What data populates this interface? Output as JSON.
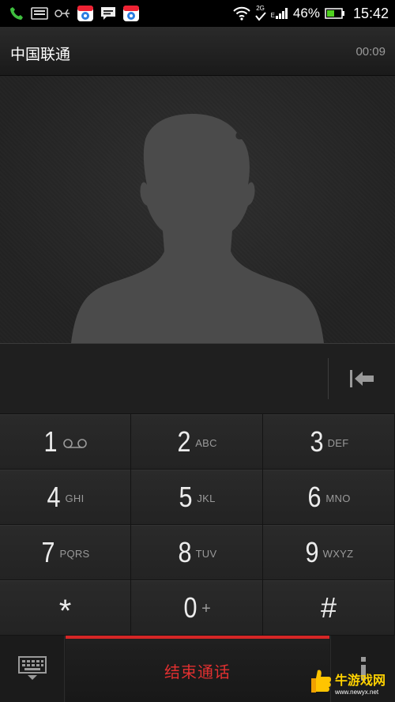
{
  "status_bar": {
    "left_icons": [
      "phone-icon",
      "message-card-icon",
      "usb-icon",
      "app-store-icon",
      "chat-icon",
      "app-store-icon"
    ],
    "network_type": "2G",
    "signal_letter": "E",
    "battery_percent": "46%",
    "time": "15:42"
  },
  "header": {
    "carrier": "中国联通",
    "call_duration": "00:09"
  },
  "keypad": {
    "keys": [
      {
        "digit": "1",
        "letters": ""
      },
      {
        "digit": "2",
        "letters": "ABC"
      },
      {
        "digit": "3",
        "letters": "DEF"
      },
      {
        "digit": "4",
        "letters": "GHI"
      },
      {
        "digit": "5",
        "letters": "JKL"
      },
      {
        "digit": "6",
        "letters": "MNO"
      },
      {
        "digit": "7",
        "letters": "PQRS"
      },
      {
        "digit": "8",
        "letters": "TUV"
      },
      {
        "digit": "9",
        "letters": "WXYZ"
      },
      {
        "digit": "*",
        "letters": ""
      },
      {
        "digit": "0",
        "letters": "+"
      },
      {
        "digit": "#",
        "letters": ""
      }
    ]
  },
  "bottom_bar": {
    "end_call_label": "结束通话"
  },
  "watermark": {
    "text": "牛游戏网",
    "url": "www.newyx.net"
  },
  "colors": {
    "end_call_accent": "#d52626"
  }
}
